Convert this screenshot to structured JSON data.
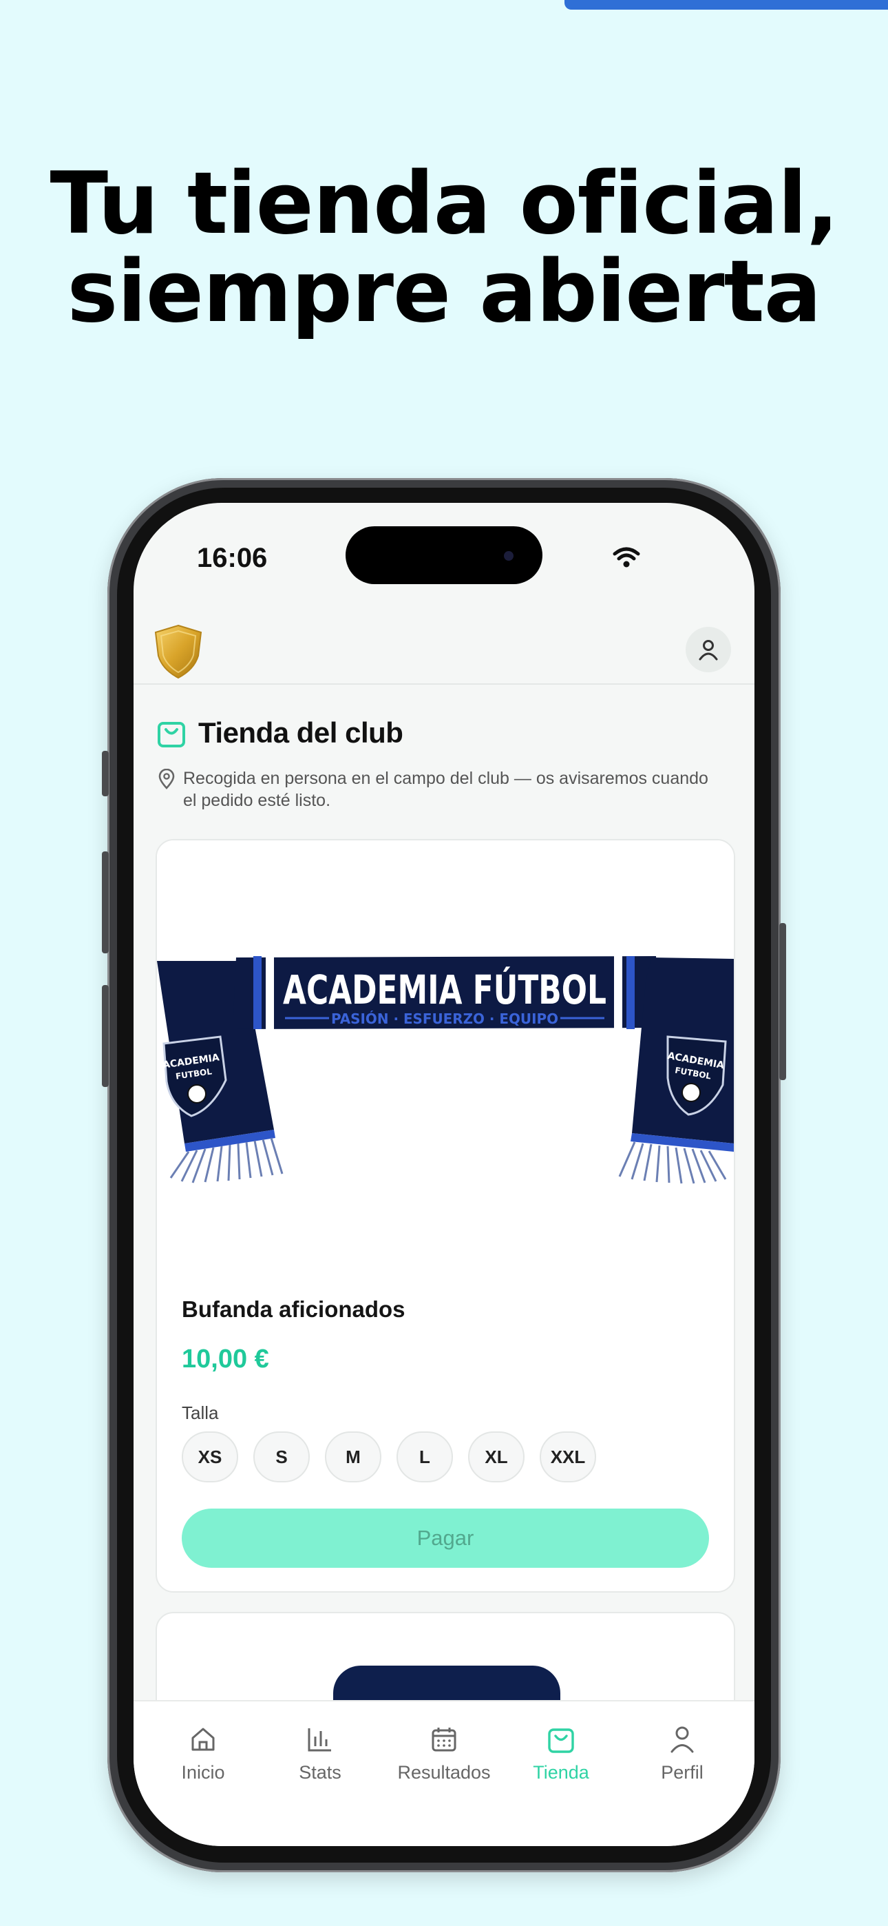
{
  "headline": {
    "line1": "Tu tienda oficial,",
    "line2": "siempre abierta"
  },
  "status_bar": {
    "time": "16:06"
  },
  "colors": {
    "background": "#e3fbfd",
    "accent_green": "#1fc99a",
    "pay_button": "#7ff1d1",
    "corner_accent": "#2f6fd6"
  },
  "header": {
    "logo_icon": "club-shield-icon",
    "profile_icon": "user-icon"
  },
  "store": {
    "title": "Tienda del club",
    "title_icon": "shopping-bag-icon",
    "pickup_icon": "location-pin-icon",
    "pickup_note": "Recogida en persona en el campo del club — os avisaremos cuando el pedido esté listo."
  },
  "product": {
    "image_text": {
      "main": "ACADEMIA FÚTBOL",
      "tagline": "PASIÓN · ESFUERZO · EQUIPO",
      "badge_line1": "ACADEMIA",
      "badge_line2": "FUTBOL"
    },
    "name": "Bufanda aficionados",
    "price": "10,00 €",
    "size_label": "Talla",
    "sizes": [
      "XS",
      "S",
      "M",
      "L",
      "XL",
      "XXL"
    ],
    "pay_label": "Pagar"
  },
  "tabs": [
    {
      "label": "Inicio",
      "icon": "home-icon",
      "active": false
    },
    {
      "label": "Stats",
      "icon": "bar-chart-icon",
      "active": false
    },
    {
      "label": "Resultados",
      "icon": "calendar-icon",
      "active": false
    },
    {
      "label": "Tienda",
      "icon": "shopping-bag-icon",
      "active": true
    },
    {
      "label": "Perfil",
      "icon": "user-icon",
      "active": false
    }
  ]
}
